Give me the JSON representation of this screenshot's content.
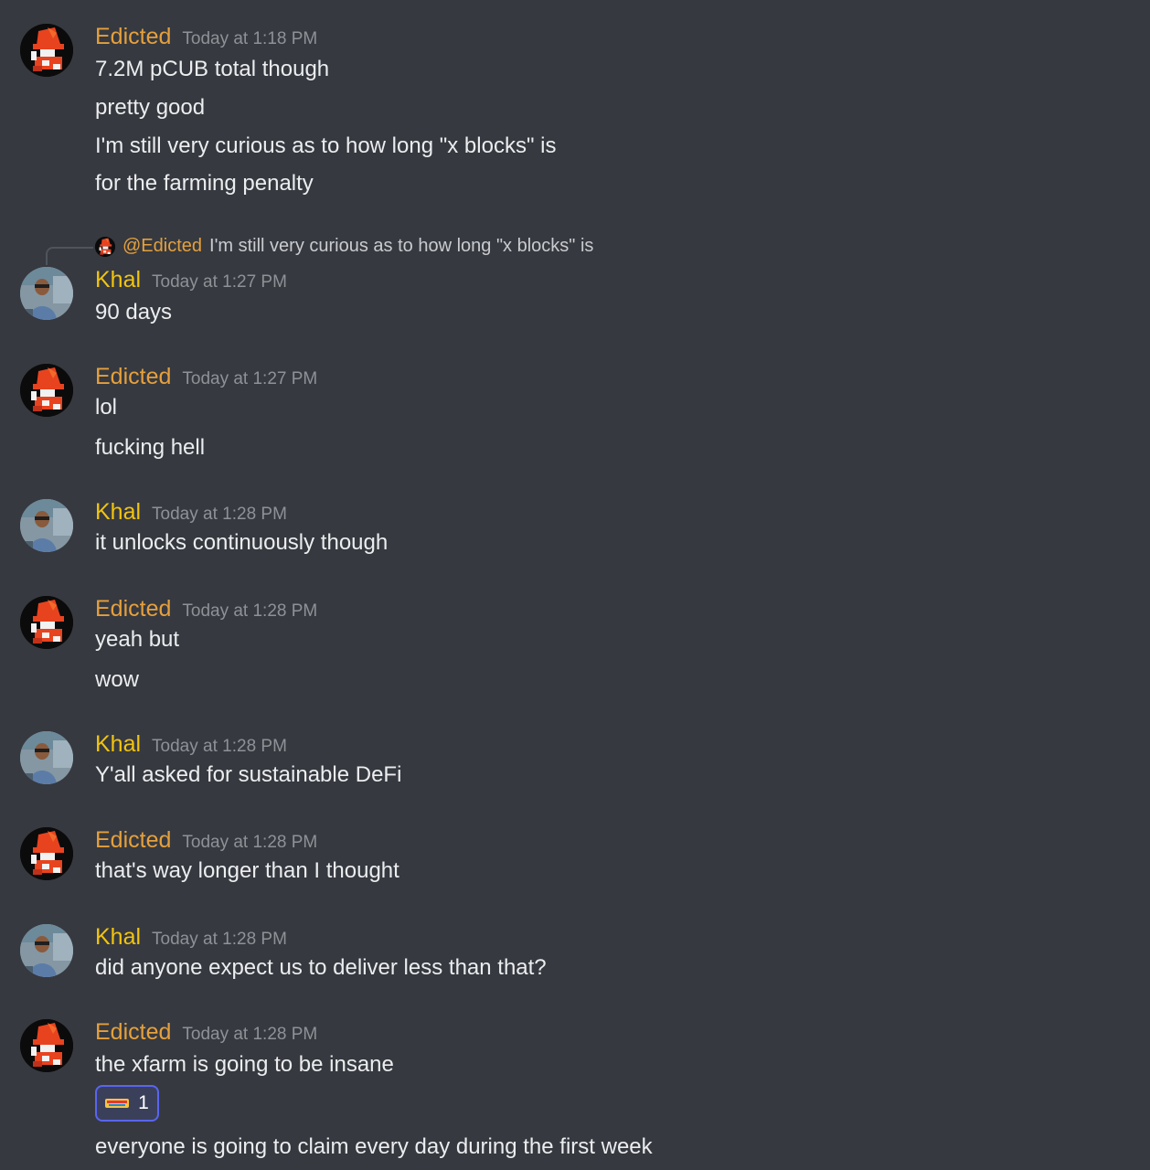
{
  "users": {
    "edicted": {
      "name": "Edicted",
      "color": "#e5a03d",
      "avatar_icon": "pixel-wizard-avatar"
    },
    "khal": {
      "name": "Khal",
      "color": "#f1c40f",
      "avatar_icon": "person-photo-avatar"
    }
  },
  "messages": [
    {
      "author": "Edicted",
      "timestamp": "Today at 1:18 PM",
      "lines": [
        "7.2M pCUB total though",
        "pretty good",
        "I'm still very curious as to how long \"x blocks\" is",
        "for the farming penalty"
      ]
    },
    {
      "author": "Khal",
      "timestamp": "Today at 1:27 PM",
      "reply": {
        "mention": "@Edicted",
        "text": "I'm still very curious as to how long \"x blocks\" is"
      },
      "lines": [
        "90 days"
      ]
    },
    {
      "author": "Edicted",
      "timestamp": "Today at 1:27 PM",
      "lines": [
        "lol",
        "fucking hell"
      ]
    },
    {
      "author": "Khal",
      "timestamp": "Today at 1:28 PM",
      "lines": [
        "it unlocks continuously though"
      ]
    },
    {
      "author": "Edicted",
      "timestamp": "Today at 1:28 PM",
      "lines": [
        "yeah but",
        "wow"
      ]
    },
    {
      "author": "Khal",
      "timestamp": "Today at 1:28 PM",
      "lines": [
        "Y'all asked for sustainable DeFi"
      ]
    },
    {
      "author": "Edicted",
      "timestamp": "Today at 1:28 PM",
      "lines": [
        "that's way longer than I thought"
      ]
    },
    {
      "author": "Khal",
      "timestamp": "Today at 1:28 PM",
      "lines": [
        "did anyone expect us to deliver less than that?"
      ]
    },
    {
      "author": "Edicted",
      "timestamp": "Today at 1:28 PM",
      "lines": [
        "the xfarm is going to be insane",
        "everyone is going to claim every day during the first week"
      ],
      "reaction": {
        "emoji": "facts-emoji",
        "count": "1"
      }
    }
  ],
  "colors": {
    "background": "#36393f",
    "reaction_border": "#5865f2"
  }
}
